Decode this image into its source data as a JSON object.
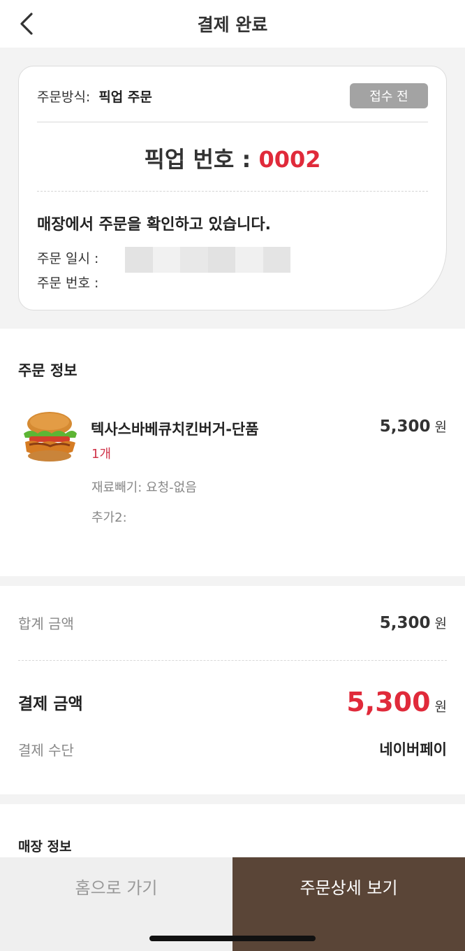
{
  "header": {
    "title": "결제 완료",
    "back_icon": "chevron-left-icon"
  },
  "order_card": {
    "method_label": "주문방식:",
    "method_value": "픽업 주문",
    "status_badge": "접수 전",
    "pickup_label": "픽업 번호 : ",
    "pickup_number": "0002",
    "message": "매장에서 주문을 확인하고 있습니다.",
    "date_label": "주문 일시 :",
    "order_no_label": "주문 번호 :"
  },
  "order_info": {
    "title": "주문 정보",
    "item": {
      "name": "텍사스바베큐치킨버거-단품",
      "quantity": "1개",
      "price": "5,300",
      "unit": "원",
      "options": [
        "재료빼기: 요청-없음",
        "추가2:"
      ]
    }
  },
  "payment": {
    "subtotal_label": "합계 금액",
    "subtotal_value": "5,300",
    "total_label": "결제 금액",
    "total_value": "5,300",
    "method_label": "결제 수단",
    "method_value": "네이버페이",
    "unit": "원"
  },
  "store": {
    "title": "매장 정보"
  },
  "bottom": {
    "home_label": "홈으로 가기",
    "detail_label": "주문상세 보기"
  },
  "colors": {
    "accent_red": "#e02a3a",
    "brand_brown": "#5a4537",
    "badge_gray": "#a3a3a3"
  }
}
